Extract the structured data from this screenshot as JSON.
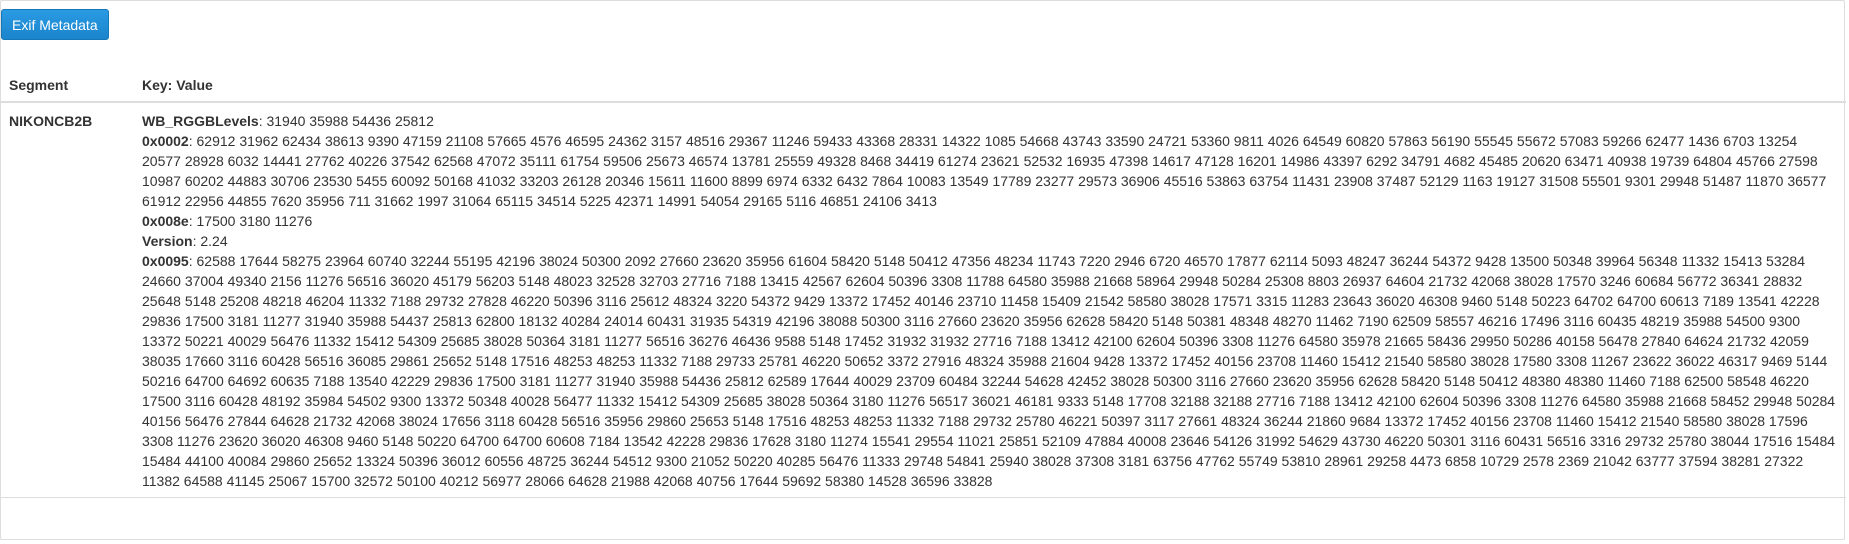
{
  "header": {
    "button_label": "Exif Metadata"
  },
  "table": {
    "columns": [
      "Segment",
      "Key: Value"
    ],
    "rows": [
      {
        "segment": "NIKONCB2B",
        "entries": [
          {
            "key": "WB_RGGBLevels",
            "value": "31940 35988 54436 25812"
          },
          {
            "key": "0x0002",
            "value": "62912 31962 62434 38613 9390 47159 21108 57665 4576 46595 24362 3157 48516 29367 11246 59433 43368 28331 14322 1085 54668 43743 33590 24721 53360 9811 4026 64549 60820 57863 56190 55545 55672 57083 59266 62477 1436 6703 13254 20577 28928 6032 14441 27762 40226 37542 62568 47072 35111 61754 59506 25673 46574 13781 25559 49328 8468 34419 61274 23621 52532 16935 47398 14617 47128 16201 14986 43397 6292 34791 4682 45485 20620 63471 40938 19739 64804 45766 27598 10987 60202 44883 30706 23530 5455 60092 50168 41032 33203 26128 20346 15611 11600 8899 6974 6332 6432 7864 10083 13549 17789 23277 29573 36906 45516 53863 63754 11431 23908 37487 52129 1163 19127 31508 55501 9301 29948 51487 11870 36577 61912 22956 44855 7620 35956 711 31662 1997 31064 65115 34514 5225 42371 14991 54054 29165 5116 46851 24106 3413"
          },
          {
            "key": "0x008e",
            "value": "17500 3180 11276"
          },
          {
            "key": "Version",
            "value": "2.24"
          },
          {
            "key": "0x0095",
            "value": "62588 17644 58275 23964 60740 32244 55195 42196 38024 50300 2092 27660 23620 35956 61604 58420 5148 50412 47356 48234 11743 7220 2946 6720 46570 17877 62114 5093 48247 36244 54372 9428 13500 50348 39964 56348 11332 15413 53284 24660 37004 49340 2156 11276 56516 36020 45179 56203 5148 48023 32528 32703 27716 7188 13415 42567 62604 50396 3308 11788 64580 35988 21668 58964 29948 50284 25308 8803 26937 64604 21732 42068 38028 17570 3246 60684 56772 36341 28832 25648 5148 25208 48218 46204 11332 7188 29732 27828 46220 50396 3116 25612 48324 3220 54372 9429 13372 17452 40146 23710 11458 15409 21542 58580 38028 17571 3315 11283 23643 36020 46308 9460 5148 50223 64702 64700 60613 7189 13541 42228 29836 17500 3181 11277 31940 35988 54437 25813 62800 18132 40284 24014 60431 31935 54319 42196 38088 50300 3116 27660 23620 35956 62628 58420 5148 50381 48348 48270 11462 7190 62509 58557 46216 17496 3116 60435 48219 35988 54500 9300 13372 50221 40029 56476 11332 15412 54309 25685 38028 50364 3181 11277 56516 36276 46436 9588 5148 17452 31932 31932 27716 7188 13412 42100 62604 50396 3308 11276 64580 35978 21665 58436 29950 50286 40158 56478 27840 64624 21732 42059 38035 17660 3116 60428 56516 36085 29861 25652 5148 17516 48253 48253 11332 7188 29733 25781 46220 50652 3372 27916 48324 35988 21604 9428 13372 17452 40156 23708 11460 15412 21540 58580 38028 17580 3308 11267 23622 36022 46317 9469 5144 50216 64700 64692 60635 7188 13540 42229 29836 17500 3181 11277 31940 35988 54436 25812 62589 17644 40029 23709 60484 32244 54628 42452 38028 50300 3116 27660 23620 35956 62628 58420 5148 50412 48380 48380 11460 7188 62500 58548 46220 17500 3116 60428 48192 35984 54502 9300 13372 50348 40028 56477 11332 15412 54309 25685 38028 50364 3180 11276 56517 36021 46181 9333 5148 17708 32188 32188 27716 7188 13412 42100 62604 50396 3308 11276 64580 35988 21668 58452 29948 50284 40156 56476 27844 64628 21732 42068 38024 17656 3118 60428 56516 35956 29860 25653 5148 17516 48253 48253 11332 7188 29732 25780 46221 50397 3117 27661 48324 36244 21860 9684 13372 17452 40156 23708 11460 15412 21540 58580 38028 17596 3308 11276 23620 36020 46308 9460 5148 50220 64700 64700 60608 7184 13542 42228 29836 17628 3180 11274 15541 29554 11021 25851 52109 47884 40008 23646 54126 31992 54629 43730 46220 50301 3116 60431 56516 3316 29732 25780 38044 17516 15484 15484 44100 40084 29860 25652 13324 50396 36012 60556 48725 36244 54512 9300 21052 50220 40285 56476 11333 29748 54841 25940 38028 37308 3181 63756 47762 55749 53810 28961 29258 4473 6858 10729 2578 2369 21042 63777 37594 38281 27322 11382 64588 41145 25067 15700 32572 50100 40212 56977 28066 64628 21988 42068 40756 17644 59692 58380 14528 36596 33828"
          }
        ]
      }
    ]
  }
}
